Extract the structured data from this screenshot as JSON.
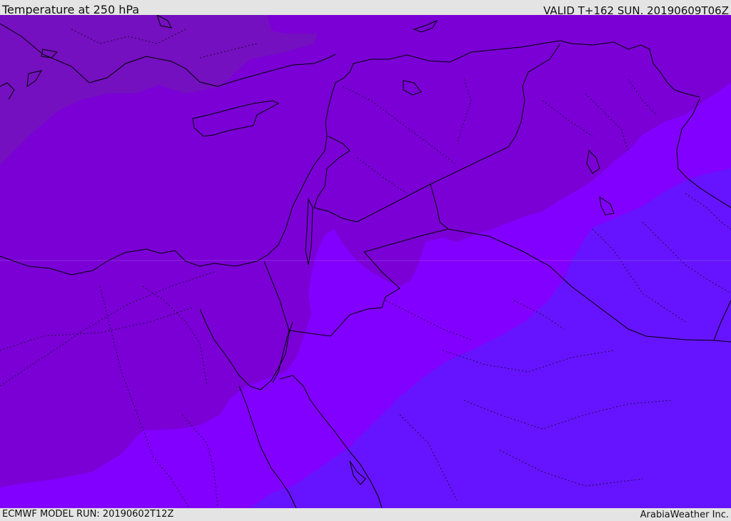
{
  "header": {
    "title": "Temperature at 250 hPa",
    "valid": "VALID T+162 SUN. 20190609T06Z"
  },
  "footer": {
    "model_run": "ECMWF MODEL RUN: 20190602T12Z",
    "credit": "ArabiaWeather Inc."
  },
  "map": {
    "field": "Temperature at 250 hPa",
    "colors": {
      "coldest_band": "#7410bf",
      "cold_band": "#7a00d6",
      "mid_band": "#8200ff",
      "warm_band": "#6614ff",
      "boundary_lines": "#000000"
    }
  }
}
